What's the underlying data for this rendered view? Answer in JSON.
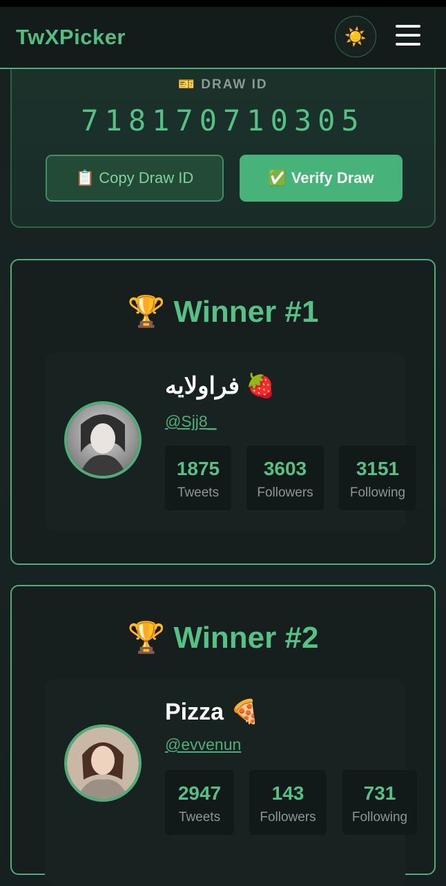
{
  "header": {
    "brand": "TwXPicker",
    "theme_icon": "sun-icon",
    "menu_icon": "hamburger-menu-icon"
  },
  "draw": {
    "label": "🎫 DRAW ID",
    "id": "718170710305",
    "copy_label": "📋 Copy Draw ID",
    "verify_label": "✅ Verify Draw"
  },
  "winners": [
    {
      "title": "🏆 Winner #1",
      "name": "فراولایه 🍓",
      "handle": "@Sjj8_",
      "stats": [
        {
          "value": "1875",
          "label": "Tweets"
        },
        {
          "value": "3603",
          "label": "Followers"
        },
        {
          "value": "3151",
          "label": "Following"
        }
      ]
    },
    {
      "title": "🏆 Winner #2",
      "name": "Pizza 🍕",
      "handle": "@evvenun",
      "stats": [
        {
          "value": "2947",
          "label": "Tweets"
        },
        {
          "value": "143",
          "label": "Followers"
        },
        {
          "value": "731",
          "label": "Following"
        }
      ]
    }
  ]
}
